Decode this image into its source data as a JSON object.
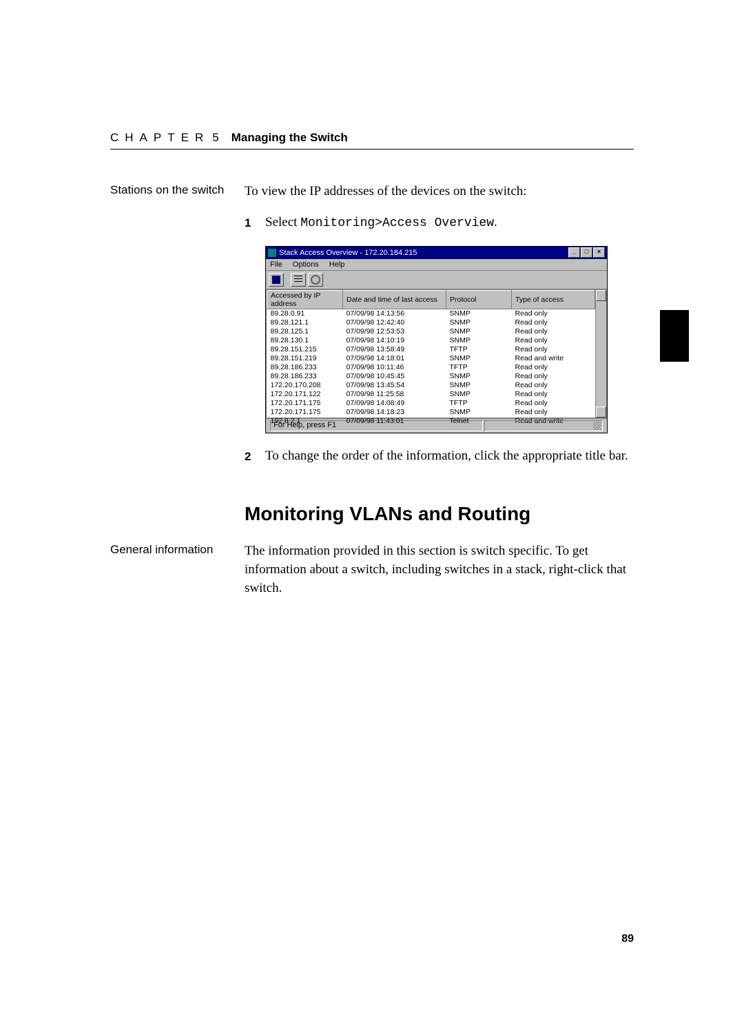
{
  "header": {
    "chapter_word": "CHAPTER",
    "chapter_num": "5",
    "chapter_title": "Managing the Switch"
  },
  "notes": {
    "stations": "Stations on the switch",
    "general": "General information"
  },
  "body": {
    "intro": "To view the IP addresses of the devices on the switch:",
    "step1_num": "1",
    "step1_prefix": "Select ",
    "step1_mono": "Monitoring>Access Overview",
    "step1_suffix": ".",
    "step2_num": "2",
    "step2_text": "To change the order of the information, click the appropriate title bar.",
    "h2": "Monitoring VLANs and Routing",
    "general_text": "The information provided in this section is switch specific. To get information about a switch, including switches in a stack, right-click that switch."
  },
  "window": {
    "title": "Stack Access Overview - 172.20.184.215",
    "menus": {
      "file": "File",
      "options": "Options",
      "help": "Help"
    },
    "btns": {
      "min": "_",
      "max": "□",
      "close": "×"
    },
    "cols": {
      "ip": "Accessed by IP address",
      "date": "Date and time of last access",
      "proto": "Protocol",
      "type": "Type of access"
    },
    "rows": [
      {
        "ip": "89.28.0.91",
        "dt": "07/09/98 14:13:56",
        "pr": "SNMP",
        "ty": "Read only"
      },
      {
        "ip": "89.28.121.1",
        "dt": "07/09/98 12:42:40",
        "pr": "SNMP",
        "ty": "Read only"
      },
      {
        "ip": "89.28.125.1",
        "dt": "07/09/98 12:53:53",
        "pr": "SNMP",
        "ty": "Read only"
      },
      {
        "ip": "89.28.130.1",
        "dt": "07/09/98 14:10:19",
        "pr": "SNMP",
        "ty": "Read only"
      },
      {
        "ip": "89.28.151.215",
        "dt": "07/09/98 13:58:49",
        "pr": "TFTP",
        "ty": "Read only"
      },
      {
        "ip": "89.28.151.219",
        "dt": "07/09/98 14:18:01",
        "pr": "SNMP",
        "ty": "Read and write"
      },
      {
        "ip": "89.28.186.233",
        "dt": "07/09/98 10:11:46",
        "pr": "TFTP",
        "ty": "Read only"
      },
      {
        "ip": "89.28.186.233",
        "dt": "07/09/98 10:45:45",
        "pr": "SNMP",
        "ty": "Read only"
      },
      {
        "ip": "172.20.170.208",
        "dt": "07/09/98 13:45:54",
        "pr": "SNMP",
        "ty": "Read only"
      },
      {
        "ip": "172.20.171.122",
        "dt": "07/09/98 11:25:58",
        "pr": "SNMP",
        "ty": "Read only"
      },
      {
        "ip": "172.20.171.175",
        "dt": "07/09/98 14:08:49",
        "pr": "TFTP",
        "ty": "Read only"
      },
      {
        "ip": "172.20.171.175",
        "dt": "07/09/98 14:18:23",
        "pr": "SNMP",
        "ty": "Read only"
      },
      {
        "ip": "192.8.2.1",
        "dt": "07/09/98 11:43:01",
        "pr": "Telnet",
        "ty": "Read and write"
      }
    ],
    "status": "For Help, press F1"
  },
  "page_num": "89"
}
